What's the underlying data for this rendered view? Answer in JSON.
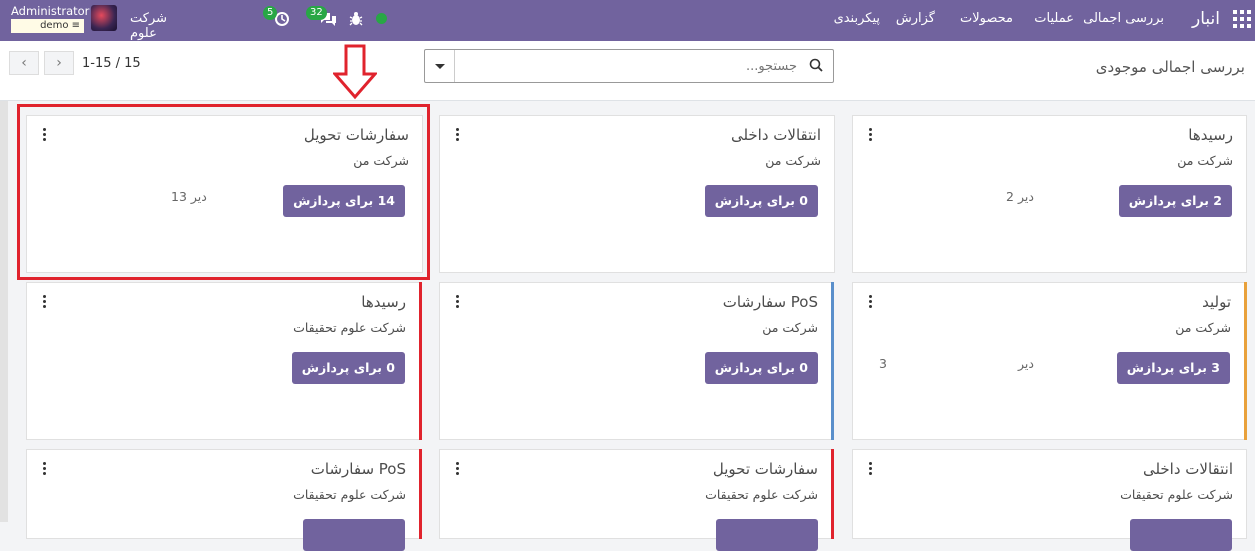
{
  "navbar": {
    "brand": "انبار",
    "menu": [
      "بررسی اجمالی",
      "عملیات",
      "محصولات",
      "گزارش",
      "پیکربندی"
    ],
    "user_name": "Administrator",
    "user_db": "demo",
    "company": "شرکت علوم تحقیقات",
    "activity_count": "5",
    "messages_count": "32",
    "accent_color": "#71639e"
  },
  "control_panel": {
    "title": "بررسی اجمالی موجودی",
    "search_placeholder": "جستجو...",
    "pager": "1-15 / 15"
  },
  "cards": [
    {
      "title": "رسیدها",
      "subtitle": "شرکت من",
      "button": "2 برای پردازش",
      "stat1": "2 دیر",
      "stat2": ""
    },
    {
      "title": "انتقالات داخلی",
      "subtitle": "شرکت من",
      "button": "0 برای پردازش",
      "stat1": "",
      "stat2": ""
    },
    {
      "title": "سفارشات تحویل",
      "subtitle": "شرکت من",
      "button": "14 برای پردازش",
      "stat1": "13 دیر",
      "stat2": ""
    },
    {
      "title": "تولید",
      "subtitle": "شرکت من",
      "button": "3 برای پردازش",
      "stat1": "دیر",
      "stat2": "3"
    },
    {
      "title": "سفارشات PoS",
      "subtitle": "شرکت من",
      "button": "0 برای پردازش",
      "stat1": "",
      "stat2": ""
    },
    {
      "title": "رسیدها",
      "subtitle": "شرکت علوم تحقیقات",
      "button": "0 برای پردازش",
      "stat1": "",
      "stat2": ""
    },
    {
      "title": "انتقالات داخلی",
      "subtitle": "شرکت علوم تحقیقات",
      "button": "",
      "stat1": "",
      "stat2": ""
    },
    {
      "title": "سفارشات تحویل",
      "subtitle": "شرکت علوم تحقیقات",
      "button": "",
      "stat1": "",
      "stat2": ""
    },
    {
      "title": "سفارشات PoS",
      "subtitle": "شرکت علوم تحقیقات",
      "button": "",
      "stat1": "",
      "stat2": ""
    }
  ],
  "stripe_colors": {
    "orange": "#e9a13b",
    "blue": "#5a8fcb",
    "red": "#e0232d"
  }
}
